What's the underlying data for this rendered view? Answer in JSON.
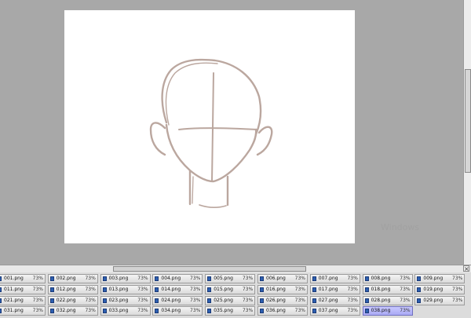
{
  "filmstrip": {
    "rows": [
      [
        {
          "name": "001.png",
          "zoom": "73%"
        },
        {
          "name": "002.png",
          "zoom": "73%"
        },
        {
          "name": "003.png",
          "zoom": "73%"
        },
        {
          "name": "004.png",
          "zoom": "73%"
        },
        {
          "name": "005.png",
          "zoom": "73%"
        },
        {
          "name": "006.png",
          "zoom": "73%"
        },
        {
          "name": "007.png",
          "zoom": "73%"
        },
        {
          "name": "008.png",
          "zoom": "73%"
        },
        {
          "name": "009.png",
          "zoom": "73%"
        }
      ],
      [
        {
          "name": "011.png",
          "zoom": "73%"
        },
        {
          "name": "012.png",
          "zoom": "73%"
        },
        {
          "name": "013.png",
          "zoom": "73%"
        },
        {
          "name": "014.png",
          "zoom": "73%"
        },
        {
          "name": "015.png",
          "zoom": "73%"
        },
        {
          "name": "016.png",
          "zoom": "73%"
        },
        {
          "name": "017.png",
          "zoom": "73%"
        },
        {
          "name": "018.png",
          "zoom": "73%"
        },
        {
          "name": "019.png",
          "zoom": "73%"
        }
      ],
      [
        {
          "name": "021.png",
          "zoom": "73%"
        },
        {
          "name": "022.png",
          "zoom": "73%"
        },
        {
          "name": "023.png",
          "zoom": "73%"
        },
        {
          "name": "024.png",
          "zoom": "73%"
        },
        {
          "name": "025.png",
          "zoom": "73%"
        },
        {
          "name": "026.png",
          "zoom": "73%"
        },
        {
          "name": "027.png",
          "zoom": "73%"
        },
        {
          "name": "028.png",
          "zoom": "73%"
        },
        {
          "name": "029.png",
          "zoom": "73%"
        }
      ],
      [
        {
          "name": "031.png",
          "zoom": "73%"
        },
        {
          "name": "032.png",
          "zoom": "73%"
        },
        {
          "name": "033.png",
          "zoom": "73%"
        },
        {
          "name": "034.png",
          "zoom": "73%"
        },
        {
          "name": "035.png",
          "zoom": "73%"
        },
        {
          "name": "036.png",
          "zoom": "73%"
        },
        {
          "name": "037.png",
          "zoom": "73%"
        },
        {
          "name": "038.png",
          "zoom": "73%"
        }
      ]
    ],
    "active": "038.png"
  },
  "watermark_text": "Windows",
  "colors": {
    "sketch_stroke": "#bba79f",
    "active_tab": "#b0b0f8",
    "workspace_bg": "#a8a8a8"
  },
  "icons": {
    "tab_file": "document-icon",
    "scroll_close": "close-icon"
  }
}
